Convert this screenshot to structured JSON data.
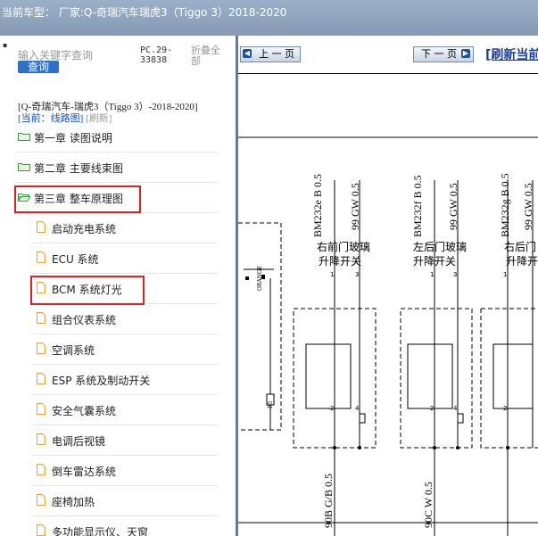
{
  "topbar": {
    "label": "当前车型：",
    "maker": "厂家:Q-奇瑞汽车瑞虎3（Tiggo 3）2018-2020"
  },
  "sidebar": {
    "search_placeholder": "输入关键字查询",
    "search_button": "查询",
    "pc_number": "PC.29-33838",
    "collapse_all": "折叠全部",
    "model_path": "[Q-奇瑞汽车-瑞虎3（Tiggo 3）-2018-2020]",
    "current_prefix": "[当前：线路图]",
    "refresh_label": "[刷新]",
    "chapters": [
      {
        "label": "第一章 读图说明"
      },
      {
        "label": "第二章 主要线束图"
      },
      {
        "label": "第三章 整车原理图"
      }
    ],
    "sub_items": [
      {
        "label": "启动充电系统"
      },
      {
        "label": "ECU 系统"
      },
      {
        "label": "BCM 系统灯光"
      },
      {
        "label": "组合仪表系统"
      },
      {
        "label": "空调系统"
      },
      {
        "label": "ESP 系统及制动开关"
      },
      {
        "label": "安全气囊系统"
      },
      {
        "label": "电调后视镜"
      },
      {
        "label": "倒车雷达系统"
      },
      {
        "label": "座椅加热"
      },
      {
        "label": "多功能显示仪、天窗"
      }
    ]
  },
  "viewer": {
    "prev_label": "上 一 页",
    "next_label": "下 一 页",
    "refresh_label": "[刷新当前",
    "wire_labels_top": [
      "BM232e B 0.5",
      "99 GW 0.5",
      "BM232f B 0.5",
      "99 GW 0.5",
      "BM232g B 0.5",
      "99 GW 0.5"
    ],
    "switch_labels": [
      "右前门玻璃",
      "升降开关",
      "左后门玻璃",
      "升降开关",
      "右后门",
      "升降开"
    ],
    "wire_labels_bottom": [
      "90B G/B 0.5",
      "90C W 0.5"
    ],
    "pin_labels": [
      "1",
      "3",
      "2",
      "4",
      "1",
      "3",
      "2",
      "4",
      "1",
      "2"
    ],
    "component_texts": [
      "ORANGE",
      "R5"
    ]
  },
  "colors": {
    "topbar": "#8b9db8",
    "highlight": "#e02020",
    "search_button": "#2f70c8",
    "folder_green": "#3a9a3a",
    "doc_orange": "#e8a040",
    "nav_blue": "#1f4fa0"
  }
}
